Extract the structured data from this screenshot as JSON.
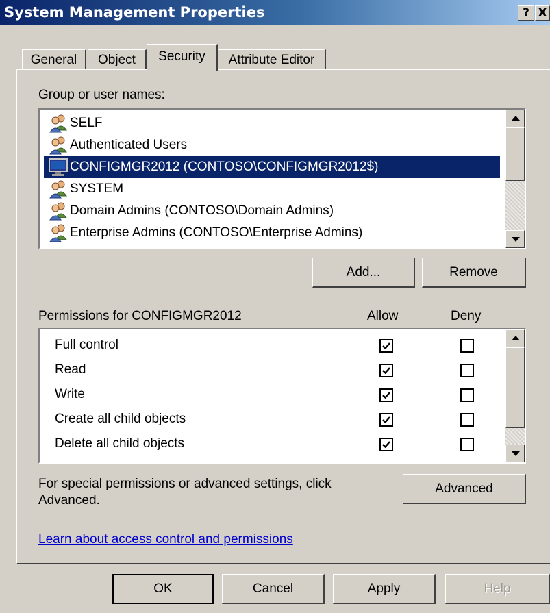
{
  "window": {
    "title": "System Management Properties",
    "help_button": "?",
    "close_button": "X"
  },
  "tabs": [
    {
      "label": "General",
      "active": false
    },
    {
      "label": "Object",
      "active": false
    },
    {
      "label": "Security",
      "active": true
    },
    {
      "label": "Attribute Editor",
      "active": false
    }
  ],
  "security": {
    "group_label": "Group or user names:",
    "principals": [
      {
        "name": "SELF",
        "icon": "users-icon",
        "selected": false
      },
      {
        "name": "Authenticated Users",
        "icon": "users-icon",
        "selected": false
      },
      {
        "name": "CONFIGMGR2012 (CONTOSO\\CONFIGMGR2012$)",
        "icon": "computer-icon",
        "selected": true
      },
      {
        "name": "SYSTEM",
        "icon": "users-icon",
        "selected": false
      },
      {
        "name": "Domain Admins (CONTOSO\\Domain Admins)",
        "icon": "users-icon",
        "selected": false
      },
      {
        "name": "Enterprise Admins (CONTOSO\\Enterprise Admins)",
        "icon": "users-icon",
        "selected": false
      }
    ],
    "add_label": "Add...",
    "remove_label": "Remove",
    "permissions_label": "Permissions for CONFIGMGR2012",
    "allow_label": "Allow",
    "deny_label": "Deny",
    "permissions": [
      {
        "name": "Full control",
        "allow": true,
        "deny": false
      },
      {
        "name": "Read",
        "allow": true,
        "deny": false
      },
      {
        "name": "Write",
        "allow": true,
        "deny": false
      },
      {
        "name": "Create all child objects",
        "allow": true,
        "deny": false
      },
      {
        "name": "Delete all child objects",
        "allow": true,
        "deny": false
      }
    ],
    "advanced_note_line1": "For special permissions or advanced settings, click",
    "advanced_note_line2": "Advanced.",
    "advanced_label": "Advanced",
    "learn_link": "Learn about access control and permissions"
  },
  "footer": {
    "ok_label": "OK",
    "cancel_label": "Cancel",
    "apply_label": "Apply",
    "help_label": "Help"
  },
  "colors": {
    "selection": "#0a246a",
    "dialog_bg": "#d4d0c8",
    "link": "#0000cc"
  }
}
